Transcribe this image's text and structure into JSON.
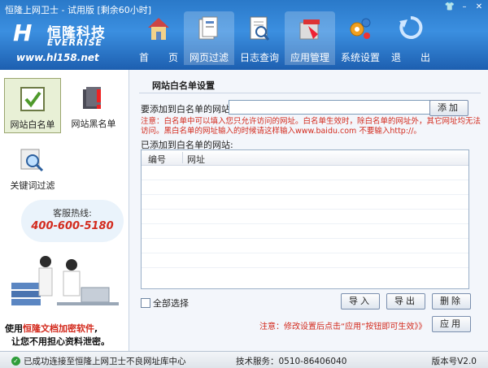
{
  "window": {
    "title": "恒隆上网卫士 - 试用版 [剩余60小时]"
  },
  "logo": {
    "company_cn": "恒隆科技",
    "company_en": "EVERRISE",
    "url": "www.hl158.net"
  },
  "nav": [
    {
      "label": "首　　页",
      "icon": "house-icon"
    },
    {
      "label": "网页过滤",
      "icon": "pages-icon"
    },
    {
      "label": "日志查询",
      "icon": "log-search-icon"
    },
    {
      "label": "应用管理",
      "icon": "app-manage-icon"
    },
    {
      "label": "系统设置",
      "icon": "gears-icon"
    },
    {
      "label": "退　　出",
      "icon": "exit-icon"
    }
  ],
  "sidebar": {
    "items": [
      {
        "label": "网站白名单",
        "icon": "check-icon"
      },
      {
        "label": "网站黑名单",
        "icon": "warning-book-icon"
      },
      {
        "label": "关键词过滤",
        "icon": "magnifier-icon"
      }
    ],
    "hotline_title": "客服热线:",
    "hotline_number": "400-600-5180",
    "promo_line1_prefix": "使用",
    "promo_line1_highlight": "恒隆文档加密软件",
    "promo_line1_suffix": ",",
    "promo_line2": "让您不用担心资料泄密。"
  },
  "main": {
    "title": "网站白名单设置",
    "add_label": "要添加到白名单的网站:",
    "url_value": "",
    "add_button": "添加",
    "note": "注意：白名单中可以填入您只允许访问的网址。白名单生效时，除白名单的网址外，其它网址均无法访问。黑白名单的网址输入的时候请这样输入www.baidu.com 不要输入http://。",
    "added_label": "已添加到白名单的网站:",
    "table": {
      "columns": [
        "编号",
        "网址"
      ],
      "rows": []
    },
    "select_all": "全部选择",
    "import_button": "导入",
    "export_button": "导出",
    "delete_button": "删除",
    "foot_note": "注意：修改设置后点击“应用”按钮即可生效》》",
    "apply_button": "应用"
  },
  "status": {
    "connection": "已成功连接至恒隆上网卫士不良网址库中心",
    "tech_service": "技术服务：0510-86406040",
    "version": "版本号V2.0"
  },
  "colors": {
    "header": "#2a79c9",
    "accent_red": "#d32b1e",
    "active_side": "#e8f0d6"
  }
}
